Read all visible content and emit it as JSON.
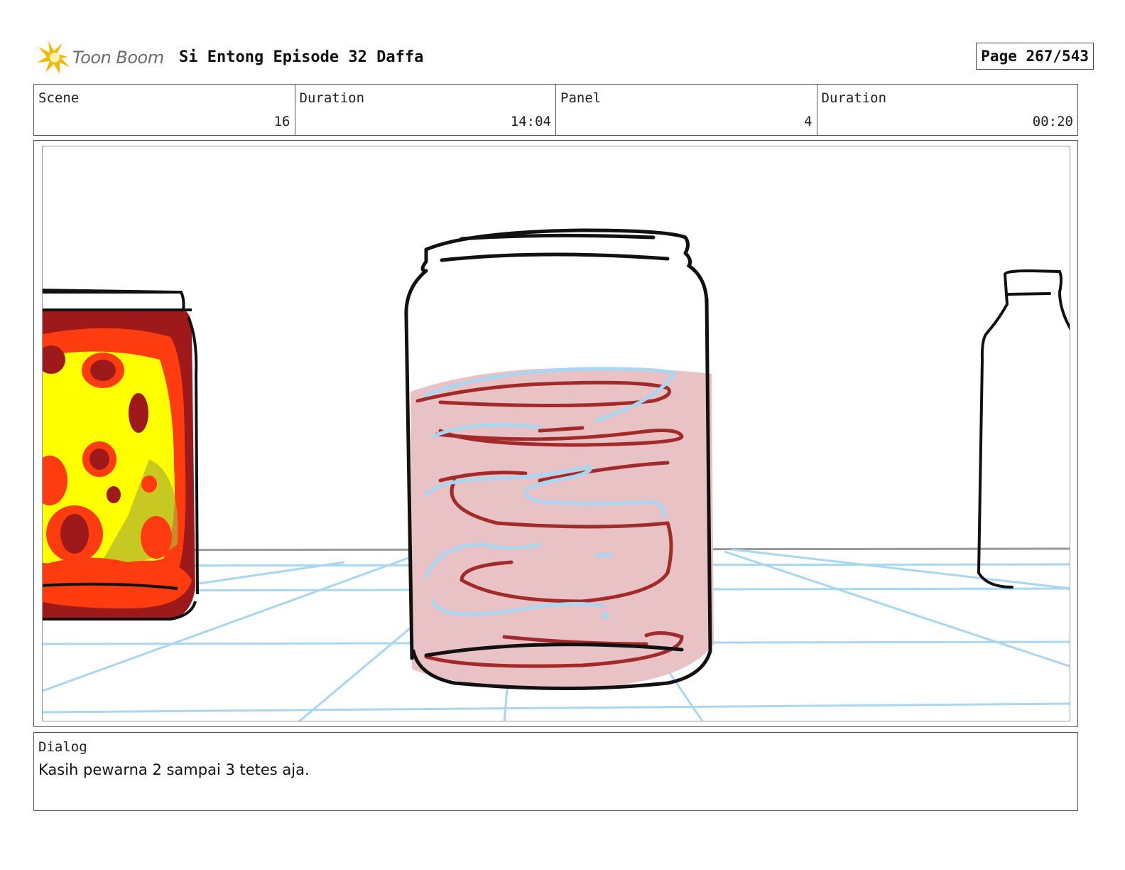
{
  "header": {
    "logo_text": "Toon Boom",
    "title": "Si Entong Episode 32 Daffa",
    "page": "Page 267/543"
  },
  "info": {
    "scene_label": "Scene",
    "scene_value": "16",
    "scene_duration_label": "Duration",
    "scene_duration_value": "14:04",
    "panel_label": "Panel",
    "panel_value": "4",
    "panel_duration_label": "Duration",
    "panel_duration_value": "00:20"
  },
  "dialog": {
    "label": "Dialog",
    "text": "Kasih pewarna 2 sampai 3 tetes aja."
  },
  "colors": {
    "jar_liquid": "#e8c2c4",
    "swirl_red": "#a32a2a",
    "swirl_blue": "#a9d6f0",
    "floor_grid": "#a9d6f0",
    "left_jar_red": "#9e1a1a",
    "left_jar_orange": "#ff3b10",
    "left_jar_yellow": "#ffff00"
  }
}
